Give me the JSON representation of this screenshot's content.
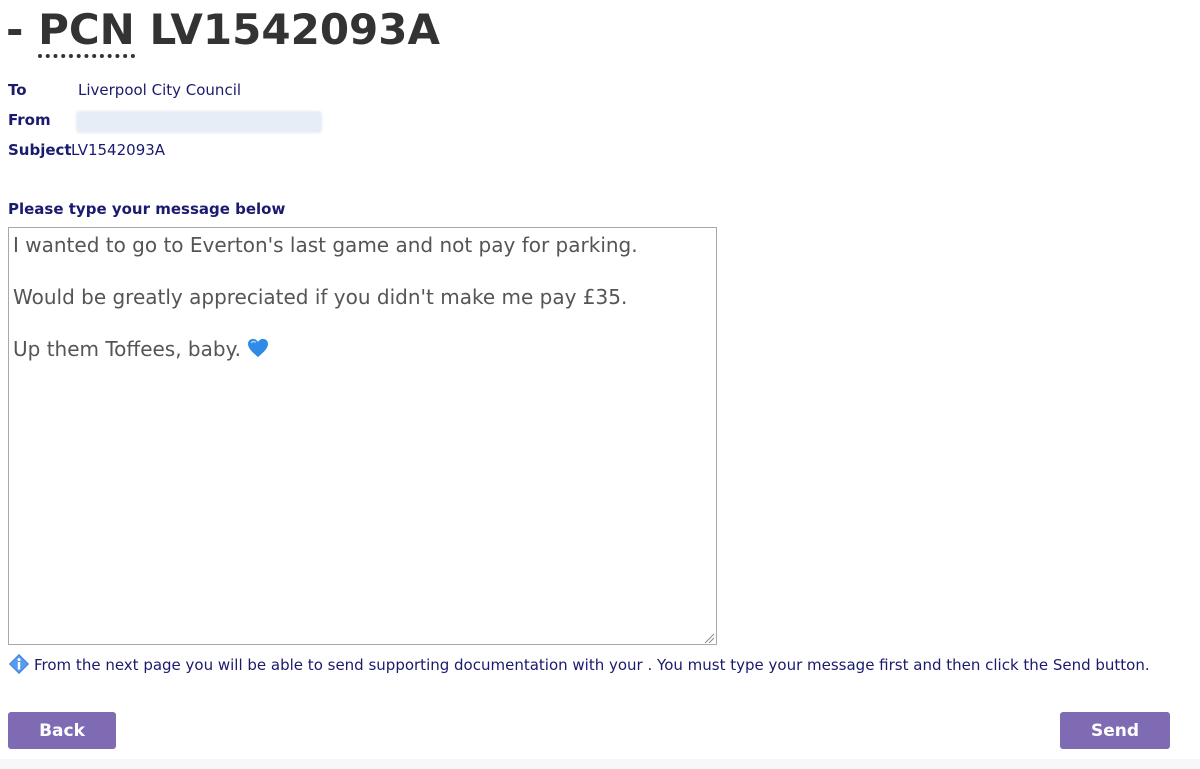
{
  "header": {
    "prefix": "- ",
    "abbr": "PCN",
    "reference": " LV1542093A"
  },
  "fields": {
    "to_label": "To",
    "to_value": "Liverpool City Council",
    "from_label": "From",
    "subject_label": "Subject",
    "subject_value": "LV1542093A"
  },
  "message": {
    "heading": "Please type your message below",
    "lines": [
      "I wanted to go to Everton's last game and not pay for parking.",
      "Would be greatly appreciated if you didn't make me pay £35.",
      "Up them Toffees, baby. "
    ],
    "emoji": "blue-heart-icon"
  },
  "info": {
    "icon": "info-icon",
    "text": "From the next page you will be able to send supporting documentation with your . You must type your message first and then click the Send button."
  },
  "buttons": {
    "back_label": "Back",
    "send_label": "Send"
  },
  "colors": {
    "label_navy": "#1a1a6e",
    "button_purple": "#7f6bb4",
    "title_gray": "#333333"
  }
}
